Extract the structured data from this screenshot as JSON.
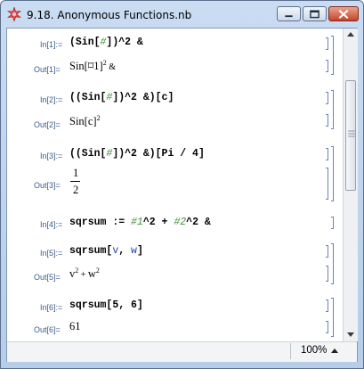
{
  "window": {
    "title": "9.18. Anonymous Functions.nb"
  },
  "cells": [
    {
      "in_label": "In[1]:=",
      "out_label": "Out[1]="
    },
    {
      "in_label": "In[2]:=",
      "out_label": "Out[2]="
    },
    {
      "in_label": "In[3]:=",
      "out_label": "Out[3]="
    },
    {
      "in_label": "In[4]:="
    },
    {
      "in_label": "In[5]:=",
      "out_label": "Out[5]="
    },
    {
      "in_label": "In[6]:=",
      "out_label": "Out[6]="
    }
  ],
  "text": {
    "c1_in_a": "(Sin[",
    "hash": "#",
    "c1_in_b": "])^2 &",
    "c1_out_a": "Sin[",
    "slot": "⌑",
    "c1_out_b": "1]",
    "sup2": "2",
    "amp": "&",
    "c2_in_a": "((Sin[",
    "c2_in_b": "])^2 &)[c]",
    "c2_out": "Sin[c]",
    "c3_in_a": "((Sin[",
    "c3_in_b": "])^2 &)[Pi / 4]",
    "c3_out_num": "1",
    "c3_out_den": "2",
    "c4_name": "sqrsum",
    "c4_a": " := ",
    "c4_s1": "#1",
    "c4_b": "^2 + ",
    "c4_s2": "#2",
    "c4_c": "^2 &",
    "c5_name": "sqrsum",
    "c5_a": "[",
    "c5_v": "v",
    "c5_comma": ", ",
    "c5_w": "w",
    "c5_b": "]",
    "c5_out_v": "v",
    "c5_out_plus": " + ",
    "c5_out_w": "w",
    "c6_name": "sqrsum",
    "c6_args": "[5, 6]",
    "c6_out": "61"
  },
  "status": {
    "zoom": "100%"
  },
  "icons": {
    "app": "mathematica-spikey-icon"
  },
  "colors": {
    "input_label": "#3d5c8c",
    "slot": "#3d8f3d",
    "symbol": "#1b43b0",
    "bracket": "#6c83b4"
  }
}
